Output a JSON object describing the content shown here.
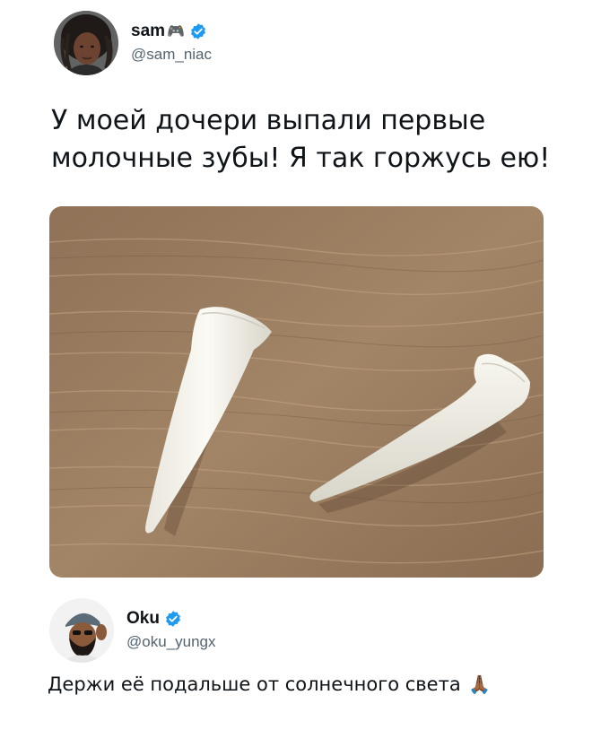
{
  "tweet": {
    "author": {
      "name": "sam",
      "name_emoji": "🎮",
      "handle": "@sam_niac",
      "verified": true
    },
    "text_line1": "У моей дочери выпали первые",
    "text_line2": "молочные зубы! Я так горжусь ею!",
    "media": {
      "subject": "two-white-teeth-on-wooden-surface"
    }
  },
  "reply": {
    "author": {
      "name": "Oku",
      "handle": "@oku_yungx",
      "verified": true
    },
    "text": "Держи её подальше от солнечного света",
    "text_emoji": "🙏🏾"
  },
  "colors": {
    "text": "#0f1419",
    "secondary": "#536471",
    "verified": "#1d9bf0",
    "wood": "#9a7b5c"
  }
}
